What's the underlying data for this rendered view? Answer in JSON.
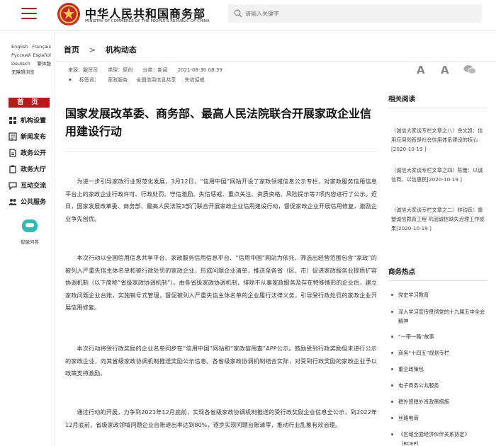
{
  "header": {
    "site_title": "中华人民共和国商务部",
    "site_subtitle": "MINISTRY OF COMMERCE OF THE PEOPLE'S REPUBLIC OF CHINA",
    "search_placeholder": "请输入关键字"
  },
  "languages": {
    "row1": [
      "English",
      "Français"
    ],
    "row2": [
      "Русский",
      "Español"
    ],
    "row3": [
      "Deutsch",
      "繁体版"
    ],
    "row4": "无障碍浏览"
  },
  "nav": {
    "home": "首 页",
    "items": [
      "机构设置",
      "新闻发布",
      "政务公开",
      "政务大厅",
      "互动交流",
      "公共服务"
    ]
  },
  "qa_label": "智能问答",
  "breadcrumb": {
    "home": "首页",
    "sep": ">",
    "current": "机构动态"
  },
  "meta": {
    "source": "来源：服贸司",
    "type": "类型：原创",
    "category": "分类：新闻",
    "date": "2021-08-30 08:39"
  },
  "tags": {
    "label": "标签词：",
    "items": [
      "家政服务",
      "全国信用信息共享",
      "失信惩戒"
    ]
  },
  "font_tools": {
    "large": "A",
    "small": "A"
  },
  "article": {
    "title": "国家发展改革委、商务部、最高人民法院联合开展家政企业信用建设行动",
    "paragraphs": [
      "为进一步引导家政行业规范化发展，3月12日，“信用中国”网站开设了家政领域信息公示专栏，对家政服务信用信息平台上的家政企业行政许可、行政处罚、守信激励、失信惩戒、重点关注、资质资格、风险提示等7项内容进行了公示。近日，国家发展改革委、商务部、最高人民法院3部门联合开展家政企业信用建设行动，督促家政企业开展信用修复，激励企业争先创优。",
      "本次行动以全国信用信息共享平台、家政服务信用信息平台、“信用中国”网站为依托，筛选出经营范围包含“家政”的被列入严重失信主体名单和被行政处罚的家政企业，形成问题企业清单，推送至各省（区、市）促进家政服务业提质扩容协调机制（以下简称“省级家政协调机制”）。由各省级家政协调机制，排除不从事家政服务及存在特殊情形的企业后，建立家政问题企业台账，实施销号式管理，督促被列入严重失信主体名单的企业履行法律义务，引导受行政处罚的家政企业开展信用修复。",
      "本次行动将受行政奖励的企业名单同步在“信用中国”网站和“家政信用查”APP公示。鼓励受到行政奖励但未进行公示的家政企业，向其省级家政协调机制推送奖励公示信息。各省级家政协调机制结合实际，对受到行政奖励的家政企业予以政策支持激励。",
      "通过行动的开展，力争到2021年12月底前，实现各省级家政协调机制推送的受行政奖励企业信息全公示，到2022年12月底前，省级家政领域问题企业台账退出率达到80%，逐步实现问题台账清零，推动行业乱象有效治理。"
    ]
  },
  "related": {
    "title": "相关阅读",
    "items": [
      "（诚信大家谈专栏文章之八）余文凯：信用应用创新是社会信用体系建设的核心[2020-10-19 ]",
      "（诚信大家谈专栏文章之四）陈蕾：以诚信商，以信惠民[2020-10-19 ]",
      "（诚信大家谈专栏文章之二）林钧跃：重塑诚信教育工程 巩固诚信缺失治理工作成果[2020-10-19 ]"
    ]
  },
  "hot": {
    "title": "商务热点",
    "items": [
      "党史学习教育",
      "深入学习宣传贯彻党的十九届五中全会精神",
      "“一带一路”故事",
      "商务“十四五”规划专栏",
      "重企政策包",
      "电子商务公共服务",
      "稳外贸稳外资政策措施",
      "丝路电商",
      "《区域全面经济伙伴关系协定》（RCEP）"
    ]
  },
  "colors": {
    "brand_red": "#b71c1c",
    "robot_teal": "#2bbfb3"
  }
}
